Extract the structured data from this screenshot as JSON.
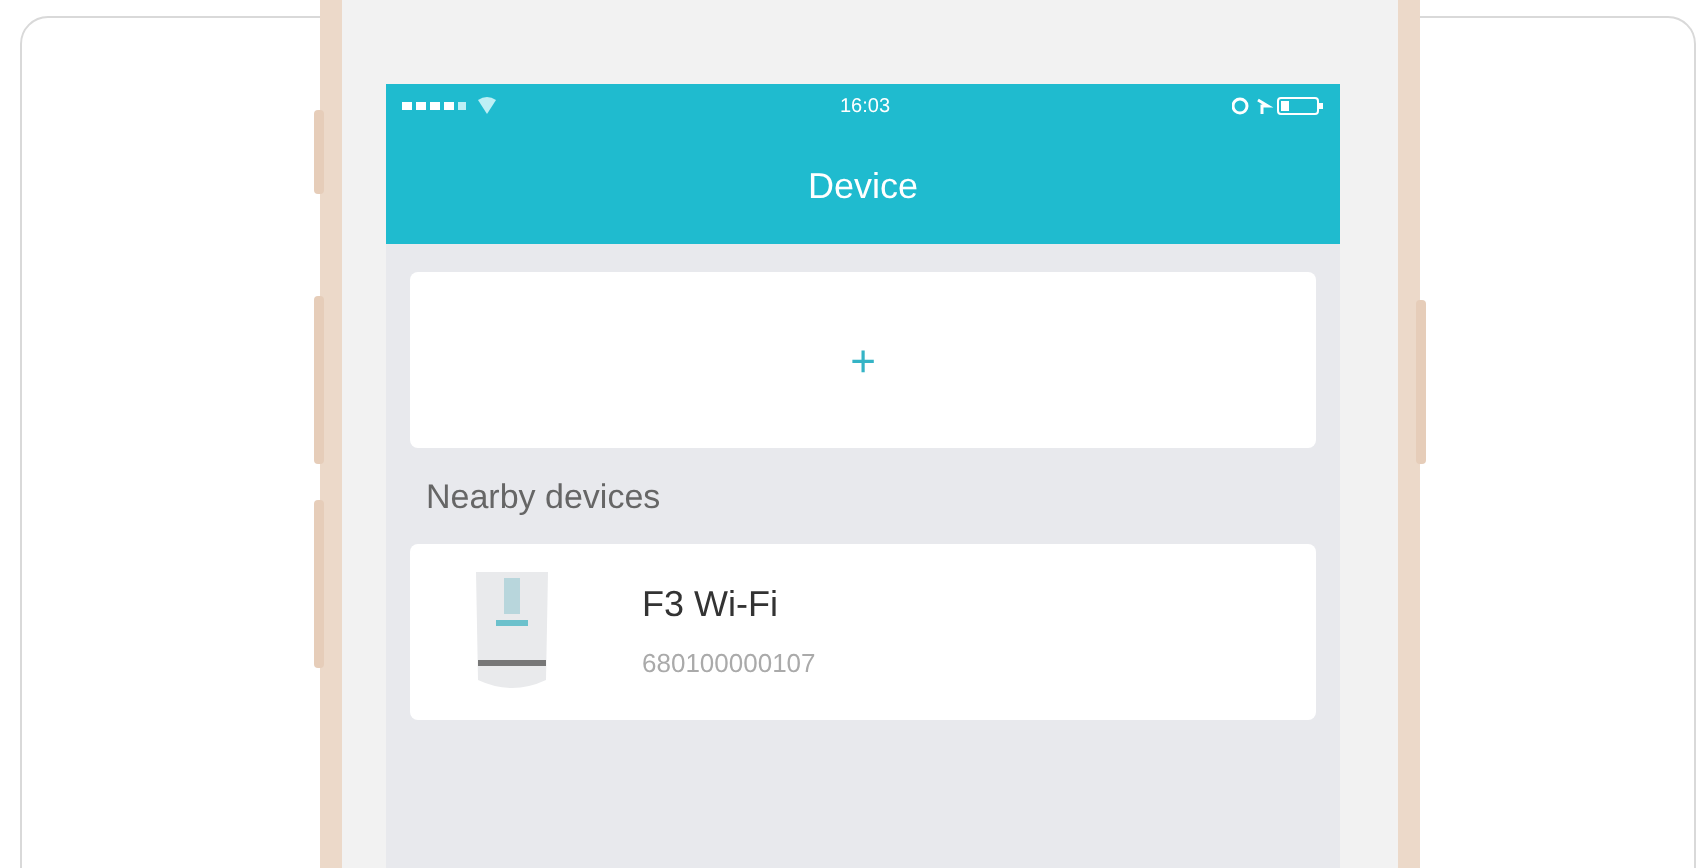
{
  "status_bar": {
    "time": "16:03"
  },
  "nav_bar": {
    "title": "Device"
  },
  "add_card": {
    "label": "+"
  },
  "section_title": "Nearby devices",
  "devices": [
    {
      "name": "F3 Wi-Fi",
      "serial": "680100000107"
    }
  ]
}
